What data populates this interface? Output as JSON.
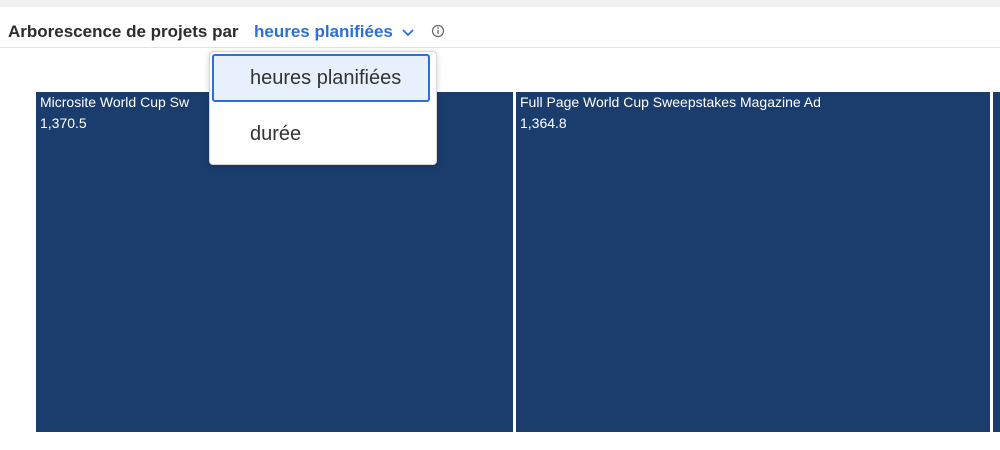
{
  "header": {
    "title": "Arborescence de projets par",
    "metric_selected": "heures planifiées"
  },
  "dropdown": {
    "options": [
      "heures planifiées",
      "durée"
    ],
    "selected_index": 0
  },
  "colors": {
    "tile": "#1b3d6d",
    "accent": "#2d6fd6"
  },
  "chart_data": {
    "type": "treemap",
    "items": [
      {
        "name": "Microsite World Cup Sw",
        "value_label": "1,370.5",
        "value": 1370.5
      },
      {
        "name": "Full Page World Cup Sweepstakes Magazine Ad",
        "value_label": "1,364.8",
        "value": 1364.8
      },
      {
        "name": "",
        "value_label": "",
        "value": null
      }
    ]
  }
}
